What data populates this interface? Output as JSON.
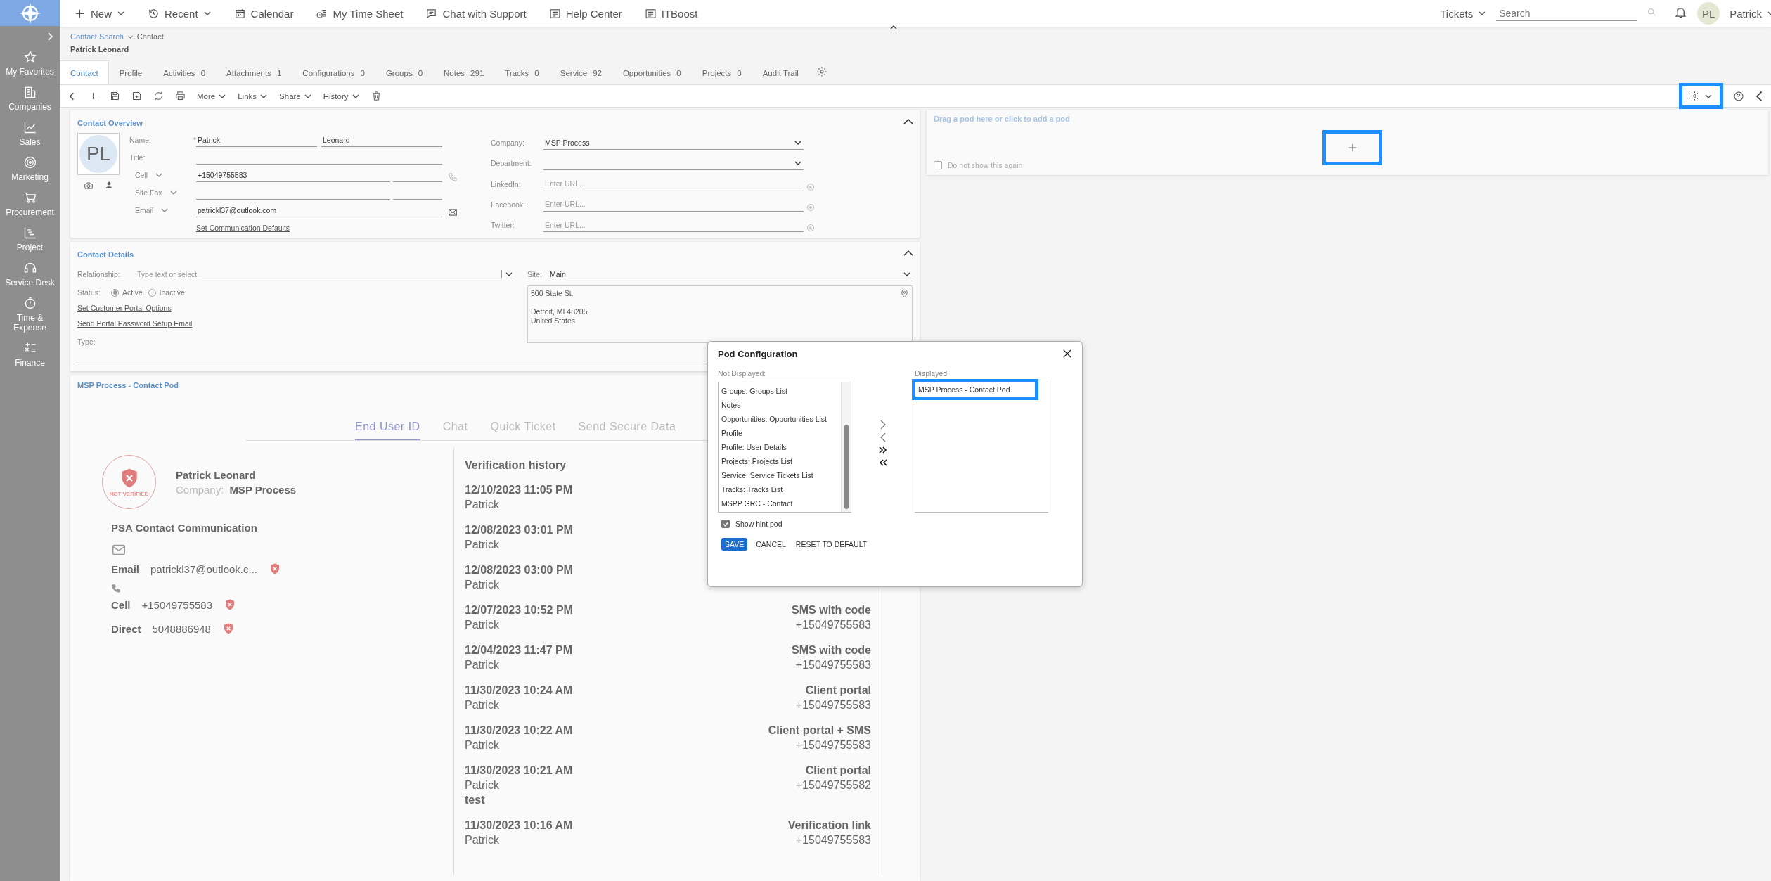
{
  "sidebar": {
    "items": [
      {
        "label": "My Favorites"
      },
      {
        "label": "Companies"
      },
      {
        "label": "Sales"
      },
      {
        "label": "Marketing"
      },
      {
        "label": "Procurement"
      },
      {
        "label": "Project"
      },
      {
        "label": "Service Desk"
      },
      {
        "label": "Time & Expense"
      },
      {
        "label": "Finance"
      }
    ]
  },
  "topnav": {
    "items": [
      {
        "label": "New",
        "has_menu": true
      },
      {
        "label": "Recent",
        "has_menu": true
      },
      {
        "label": "Calendar",
        "has_menu": false
      },
      {
        "label": "My Time Sheet",
        "has_menu": false
      },
      {
        "label": "Chat with Support",
        "has_menu": false
      },
      {
        "label": "Help Center",
        "has_menu": false
      },
      {
        "label": "ITBoost",
        "has_menu": false
      }
    ],
    "tickets": "Tickets",
    "search": {
      "placeholder": "Search"
    },
    "user": {
      "initials": "PL",
      "name": "Patrick"
    }
  },
  "breadcrumb": [
    "Contact Search",
    "Contact"
  ],
  "page_title": "Patrick Leonard",
  "tabs": [
    {
      "label": "Contact",
      "selected": true
    },
    {
      "label": "Profile",
      "selected": false
    },
    {
      "label": "Activities",
      "count": "0",
      "selected": false
    },
    {
      "label": "Attachments",
      "count": "1",
      "selected": false
    },
    {
      "label": "Configurations",
      "count": "0",
      "selected": false
    },
    {
      "label": "Groups",
      "count": "0",
      "selected": false
    },
    {
      "label": "Notes",
      "count": "291",
      "selected": false
    },
    {
      "label": "Tracks",
      "count": "0",
      "selected": false
    },
    {
      "label": "Service",
      "count": "92",
      "selected": false
    },
    {
      "label": "Opportunities",
      "count": "0",
      "selected": false
    },
    {
      "label": "Projects",
      "count": "0",
      "selected": false
    },
    {
      "label": "Audit Trail",
      "selected": false
    }
  ],
  "toolbar": {
    "menus": [
      "More",
      "Links",
      "Share",
      "History"
    ]
  },
  "contact_overview": {
    "title": "Contact Overview",
    "initials": "PL",
    "labels": {
      "name": "Name:",
      "required": "*",
      "title": "Title:",
      "company": "Company:",
      "department": "Department:"
    },
    "social": [
      {
        "label": "LinkedIn:",
        "placeholder": "Enter URL..."
      },
      {
        "label": "Facebook:",
        "placeholder": "Enter URL..."
      },
      {
        "label": "Twitter:",
        "placeholder": "Enter URL..."
      }
    ],
    "first_name": "Patrick",
    "last_name": "Leonard",
    "phones": [
      {
        "type": "Cell",
        "value": "+15049755583"
      },
      {
        "type": "Site Fax"
      }
    ],
    "email": {
      "type": "Email",
      "value": "patrickl37@outlook.com"
    },
    "defaults_link": "Set Communication Defaults",
    "company": "MSP Process"
  },
  "contact_details": {
    "title": "Contact Details",
    "relationship_label": "Relationship:",
    "relationship_placeholder": "Type text or select",
    "status_label": "Status:",
    "status_options": [
      {
        "label": "Active",
        "selected": true
      },
      {
        "label": "Inactive",
        "selected": false
      }
    ],
    "links": [
      "Set Customer Portal Options",
      "Send Portal Password Setup Email"
    ],
    "type_label": "Type:",
    "site_label": "Site:",
    "site": "Main",
    "address": {
      "street": "500 State St.",
      "lines": [
        "Detroit, MI 48205",
        "United States"
      ]
    }
  },
  "pod": {
    "title": "MSP Process - Contact Pod",
    "tabs": [
      {
        "label": "End User ID",
        "selected": true
      },
      {
        "label": "Chat",
        "selected": false
      },
      {
        "label": "Quick Ticket",
        "selected": false
      },
      {
        "label": "Send Secure Data",
        "selected": false
      }
    ],
    "badge": "NOT VERIFIED",
    "name": "Patrick Leonard",
    "company_label": "Company:",
    "company": "MSP Process",
    "communication_title": "PSA Contact Communication",
    "channels": [
      {
        "kind": "email",
        "label": "Email",
        "value": "patrickl37@outlook.c..."
      },
      {
        "kind": "phone",
        "label": "Cell",
        "value": "+15049755583"
      },
      {
        "kind": "phone",
        "label": "Direct",
        "value": "5048886948"
      }
    ],
    "history_title": "Verification history",
    "history": [
      {
        "date": "12/10/2023 11:05 PM",
        "user": "Patrick"
      },
      {
        "date": "12/08/2023 03:01 PM",
        "user": "Patrick"
      },
      {
        "date": "12/08/2023 03:00 PM",
        "user": "Patrick"
      },
      {
        "date": "12/07/2023 10:52 PM",
        "user": "Patrick",
        "method": "SMS with code",
        "phone": "+15049755583"
      },
      {
        "date": "12/04/2023 11:47 PM",
        "user": "Patrick",
        "method": "SMS with code",
        "phone": "+15049755583"
      },
      {
        "date": "11/30/2023 10:24 AM",
        "user": "Patrick",
        "method": "Client portal",
        "phone": "+15049755583"
      },
      {
        "date": "11/30/2023 10:22 AM",
        "user": "Patrick",
        "method": "Client portal + SMS",
        "phone": "+15049755583"
      },
      {
        "date": "11/30/2023 10:21 AM",
        "user": "Patrick",
        "note": "test",
        "method": "Client portal",
        "phone": "+15049755582"
      },
      {
        "date": "11/30/2023 10:16 AM",
        "user": "Patrick",
        "method": "Verification link",
        "phone": "+15049755583"
      }
    ]
  },
  "right_panel": {
    "settings_highlighted": true,
    "hint": "Drag a pod here or click to add a pod",
    "add_highlighted": true,
    "dont_show": {
      "label": "Do not show this again",
      "checked": false
    }
  },
  "dialog": {
    "title": "Pod Configuration",
    "not_displayed_label": "Not Displayed:",
    "displayed_label": "Displayed:",
    "not_displayed": [
      "Groups: Groups List",
      "Notes",
      "Opportunities: Opportunities List",
      "Profile",
      "Profile: User Details",
      "Projects: Projects List",
      "Service: Service Tickets List",
      "Tracks: Tracks List",
      "MSPP GRC - Contact"
    ],
    "displayed": [
      {
        "label": "MSP Process - Contact Pod",
        "highlighted": true
      }
    ],
    "show_hint": {
      "label": "Show hint pod",
      "checked": true
    },
    "buttons": [
      {
        "label": "SAVE",
        "kind": "primary"
      },
      {
        "label": "CANCEL",
        "kind": "text"
      },
      {
        "label": "RESET TO DEFAULT",
        "kind": "text"
      }
    ]
  }
}
